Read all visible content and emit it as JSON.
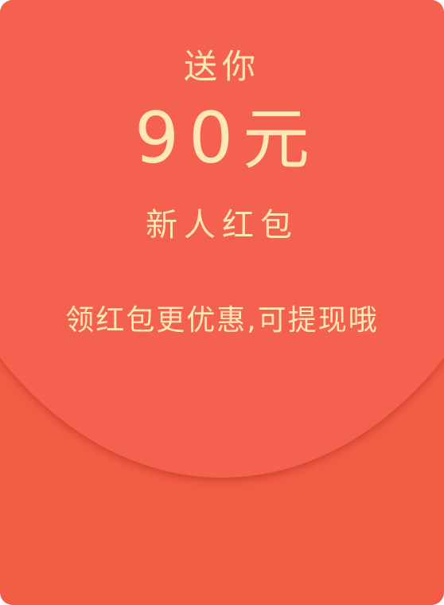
{
  "envelope": {
    "gift_text": "送你",
    "amount_number": "90",
    "amount_unit": "元",
    "subtitle": "新人红包",
    "promo_text": "领红包更优惠,可提现哦"
  },
  "colors": {
    "envelope_top": "#f4614e",
    "envelope_bottom": "#f25c45",
    "text_gold": "#fde8b6"
  }
}
